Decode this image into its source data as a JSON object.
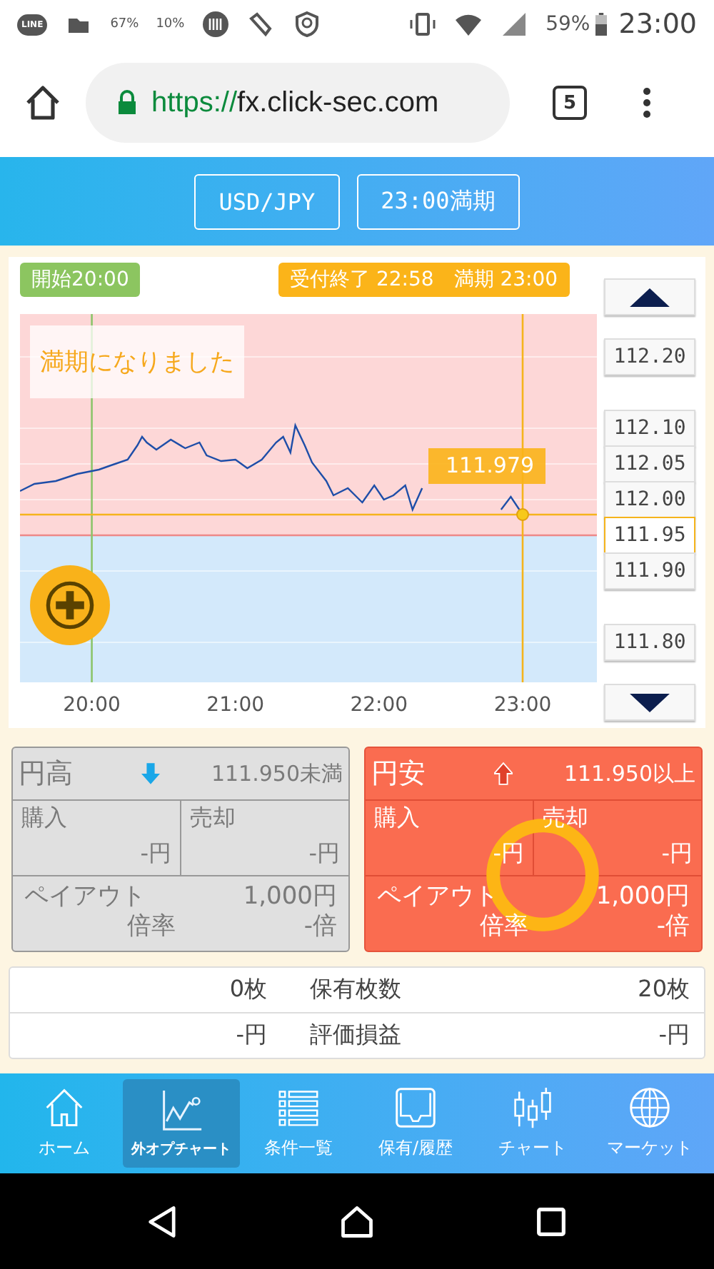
{
  "status_bar": {
    "app_badge": "LINE",
    "notifications": [
      "67%",
      "10%"
    ],
    "battery": "59%",
    "time": "23:00"
  },
  "browser": {
    "url_scheme": "https://",
    "url_host": "fx.click-sec.com",
    "tab_count": "5"
  },
  "header": {
    "buttons": [
      "USD/JPY",
      "23:00満期"
    ]
  },
  "chart": {
    "price_buttons": [
      {
        "selected": false
      },
      {
        "selected": false
      },
      {
        "selected": false
      },
      {
        "selected": false
      },
      {
        "selected": true
      },
      {
        "selected": false
      },
      {
        "selected": false
      }
    ],
    "start_label": "開始20:00",
    "end_label": "受付終了 22:58　満期 23:00",
    "message": "満期になりました",
    "current_price": "111.979",
    "chart_data": {
      "type": "line",
      "xlim": [
        19.5,
        23.517
      ],
      "ylim": [
        111.744,
        112.26
      ],
      "xticks": [
        {
          "value": 20,
          "label": "20:00"
        },
        {
          "value": 21,
          "label": "21:00"
        },
        {
          "value": 22,
          "label": "22:00"
        },
        {
          "value": 23,
          "label": "23:00"
        }
      ],
      "yticks": [
        {
          "value": 112.2,
          "label": "112.20"
        },
        {
          "value": 112.1,
          "label": "112.10"
        },
        {
          "value": 112.05,
          "label": "112.05"
        },
        {
          "value": 112.0,
          "label": "112.00"
        },
        {
          "value": 111.95,
          "label": "111.95"
        },
        {
          "value": 111.9,
          "label": "111.90"
        },
        {
          "value": 111.8,
          "label": "111.80"
        }
      ],
      "grid": true,
      "bands": [
        {
          "axis": "y",
          "from": 111.95,
          "to": 112.26,
          "color": "#fdd7d7"
        },
        {
          "axis": "y",
          "from": 111.744,
          "to": 111.95,
          "color": "#d3e9fb"
        }
      ],
      "ref_lines": [
        {
          "axis": "y",
          "value": 111.95,
          "color": "#ee8888"
        },
        {
          "axis": "x",
          "value": 20,
          "color": "#8cc56a"
        },
        {
          "axis": "x",
          "value": 23,
          "color": "#f5b41c"
        },
        {
          "axis": "y",
          "value": 111.979,
          "color": "#f5b41c"
        }
      ],
      "x": [
        19.5,
        19.6,
        19.75,
        19.9,
        20.05,
        20.133,
        20.25,
        20.317,
        20.35,
        20.383,
        20.45,
        20.55,
        20.65,
        20.75,
        20.8,
        20.9,
        21.0,
        21.083,
        21.183,
        21.283,
        21.333,
        21.383,
        21.417,
        21.483,
        21.533,
        21.633,
        21.683,
        21.783,
        21.883,
        21.967,
        22.033,
        22.1,
        22.183,
        22.233,
        22.3,
        22.383,
        22.483,
        22.583,
        22.65,
        22.733,
        22.783,
        22.85,
        22.917,
        23.0
      ],
      "series": [
        {
          "color": "#1e4ea8",
          "values": [
            112.012,
            112.022,
            112.026,
            112.036,
            112.042,
            112.048,
            112.056,
            112.076,
            112.088,
            112.08,
            112.07,
            112.084,
            112.072,
            112.08,
            112.062,
            112.054,
            112.056,
            112.044,
            112.056,
            112.08,
            112.088,
            112.066,
            112.104,
            112.076,
            112.052,
            112.026,
            112.006,
            112.016,
            111.996,
            112.02,
            112.0,
            112.006,
            112.02,
            111.986,
            112.016,
            null,
            null,
            null,
            null,
            null,
            null,
            111.986,
            112.004,
            111.979
          ]
        }
      ]
    }
  },
  "panels": [
    {
      "kind": "down",
      "selected": false,
      "title": "円高",
      "condition": "111.950未満",
      "buy_label": "購入",
      "buy_value": "-円",
      "sell_label": "売却",
      "sell_value": "-円",
      "payout_label": "ペイアウト",
      "payout_value": "1,000円",
      "ratio_label": "倍率",
      "ratio_value": "-倍"
    },
    {
      "kind": "up",
      "selected": true,
      "title": "円安",
      "condition": "111.950以上",
      "buy_label": "購入",
      "buy_value": "-円",
      "sell_label": "売却",
      "sell_value": "-円",
      "payout_label": "ペイアウト",
      "payout_value": "1,000円",
      "ratio_label": "倍率",
      "ratio_value": "-倍"
    }
  ],
  "holdings": [
    {
      "left": "0枚",
      "label": "保有枚数",
      "right": "20枚"
    },
    {
      "left": "-円",
      "label": "評価損益",
      "right": "-円"
    }
  ],
  "nav": [
    {
      "kind": "home",
      "label": "ホーム",
      "selected": false
    },
    {
      "kind": "chart",
      "label": "外オプチャート",
      "selected": true
    },
    {
      "kind": "list",
      "label": "条件一覧",
      "selected": false
    },
    {
      "kind": "tray",
      "label": "保有/履歴",
      "selected": false
    },
    {
      "kind": "candles",
      "label": "チャート",
      "selected": false
    },
    {
      "kind": "globe",
      "label": "マーケット",
      "selected": false
    }
  ]
}
